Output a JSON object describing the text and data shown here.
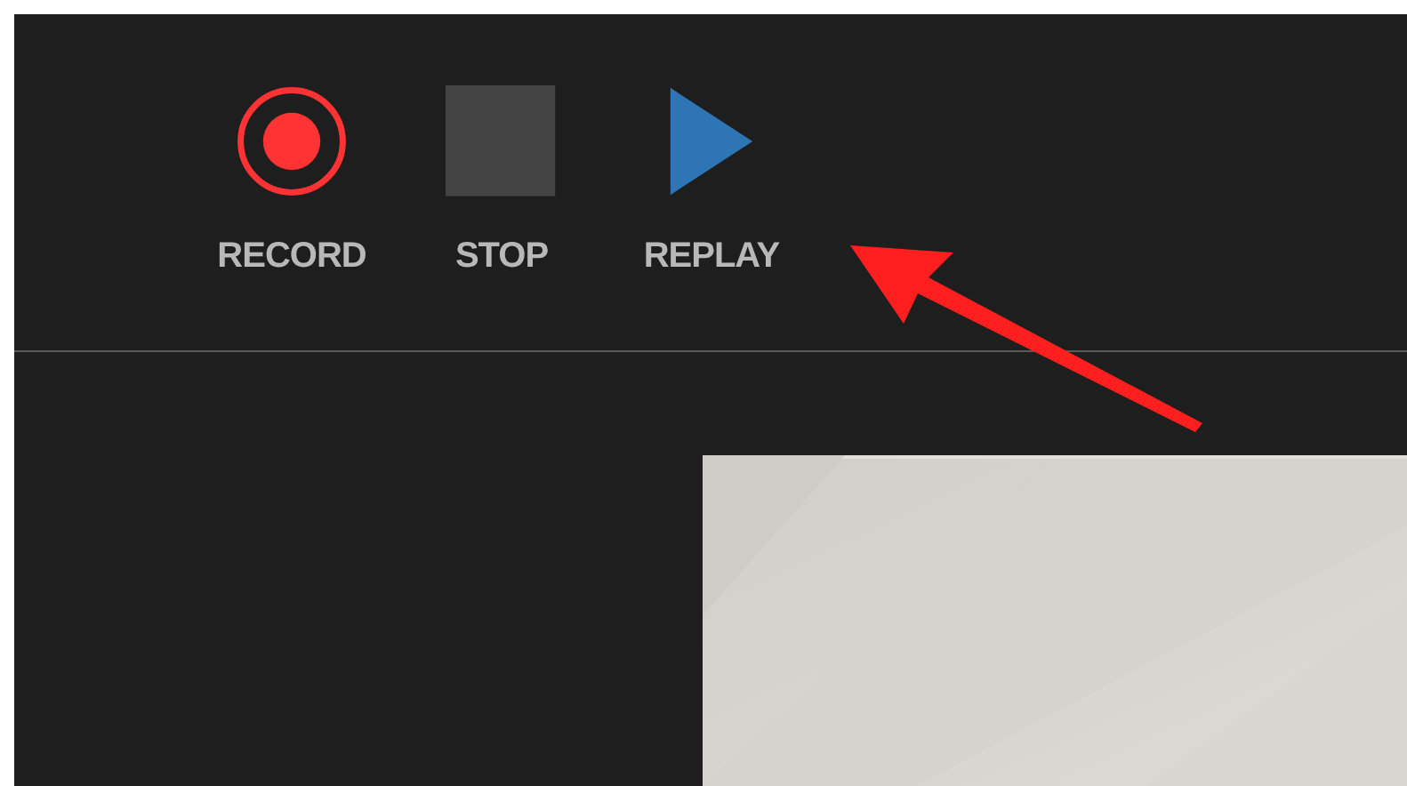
{
  "toolbar": {
    "buttons": [
      {
        "kind": "record",
        "label": "RECORD"
      },
      {
        "kind": "stop",
        "label": "STOP"
      },
      {
        "kind": "replay",
        "label": "REPLAY"
      }
    ]
  }
}
